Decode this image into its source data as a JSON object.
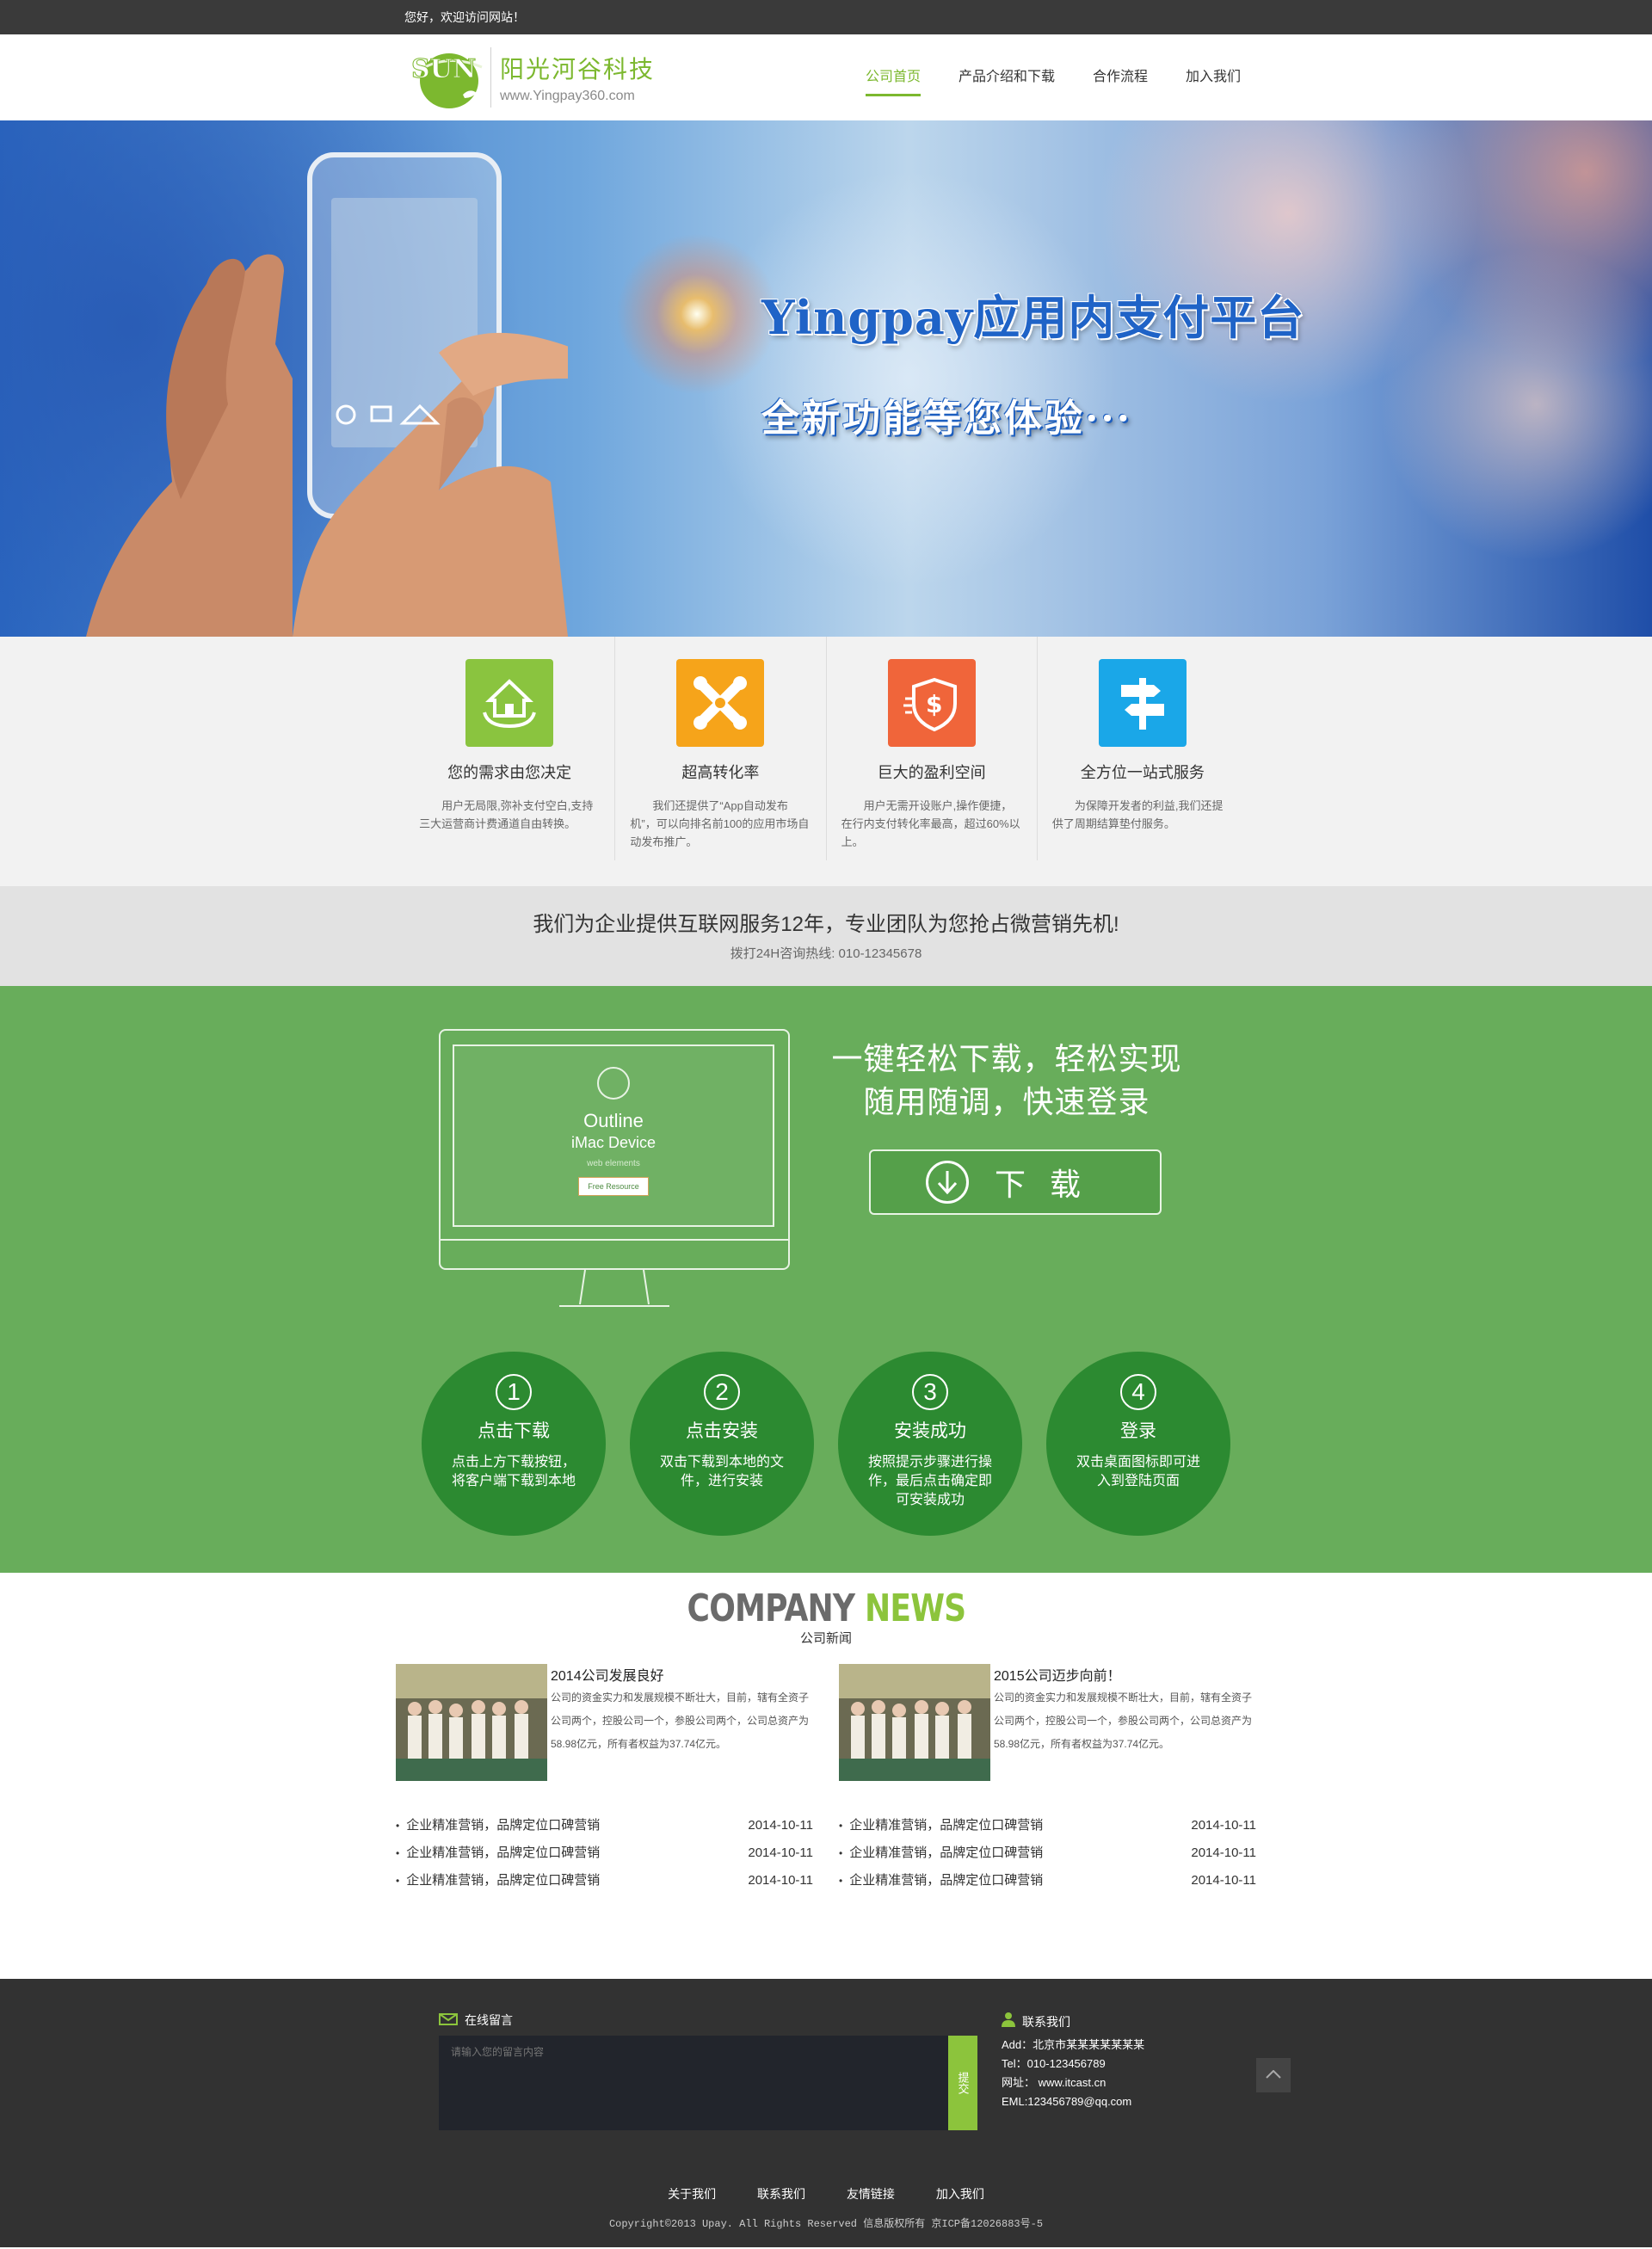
{
  "topbar": {
    "welcome": "您好，欢迎访问网站！"
  },
  "header": {
    "logo_badge": "SUN",
    "logo_cn": "阳光河谷科技",
    "logo_en": "www.Yingpay360.com",
    "nav": [
      {
        "label": "公司首页",
        "active": true
      },
      {
        "label": "产品介绍和下载",
        "active": false
      },
      {
        "label": "合作流程",
        "active": false
      },
      {
        "label": "加入我们",
        "active": false
      }
    ]
  },
  "banner": {
    "title": "Yingpay应用内支付平台",
    "subtitle": "全新功能等您体验···"
  },
  "features": [
    {
      "icon": "house-hands-icon",
      "color": "#8ac43f",
      "title": "您的需求由您决定",
      "desc": "用户无局限,弥补支付空白,支持三大运营商计费通道自由转换。"
    },
    {
      "icon": "puzzle-x-icon",
      "color": "#f6a41a",
      "title": "超高转化率",
      "desc": "我们还提供了“App自动发布机”，可以向排名前100的应用市场自动发布推广。"
    },
    {
      "icon": "dollar-shield-icon",
      "color": "#f0653a",
      "title": "巨大的盈利空间",
      "desc": "用户无需开设账户,操作便捷，在行内支付转化率最高，超过60%以上。"
    },
    {
      "icon": "signpost-icon",
      "color": "#1aa7e8",
      "title": "全方位一站式服务",
      "desc": "为保障开发者的利益,我们还提供了周期结算垫付服务。"
    }
  ],
  "slogan": {
    "title": "我们为企业提供互联网服务12年，专业团队为您抢占微营销先机!",
    "hotline": "拨打24H咨询热线: 010-12345678"
  },
  "download": {
    "mac_title": "Outline",
    "mac_sub": "iMac Device",
    "mac_small": "web elements",
    "mac_btn": "Free Resource",
    "line1": "一键轻松下载，轻松实现",
    "line2": "随用随调，快速登录",
    "button": "下载",
    "steps": [
      {
        "num": "1",
        "title": "点击下载",
        "desc": "点击上方下载按钮，将客户端下载到本地"
      },
      {
        "num": "2",
        "title": "点击安装",
        "desc": "双击下载到本地的文件，进行安装"
      },
      {
        "num": "3",
        "title": "安装成功",
        "desc": "按照提示步骤进行操作，最后点击确定即可安装成功"
      },
      {
        "num": "4",
        "title": "登录",
        "desc": "双击桌面图标即可进入到登陆页面"
      }
    ]
  },
  "news": {
    "title_a": "COMPANY",
    "title_b": "NEWS",
    "subtitle": "公司新闻",
    "columns": [
      {
        "headline": "2014公司发展良好",
        "summary": "公司的资金实力和发展规模不断壮大，目前，辖有全资子公司两个，控股公司一个，参股公司两个，公司总资产为58.98亿元，所有者权益为37.74亿元。",
        "items": [
          {
            "title": "企业精准营销，品牌定位口碑营销",
            "date": "2014-10-11"
          },
          {
            "title": "企业精准营销，品牌定位口碑营销",
            "date": "2014-10-11"
          },
          {
            "title": "企业精准营销，品牌定位口碑营销",
            "date": "2014-10-11"
          }
        ]
      },
      {
        "headline": "2015公司迈步向前！",
        "summary": "公司的资金实力和发展规模不断壮大，目前，辖有全资子公司两个，控股公司一个，参股公司两个，公司总资产为58.98亿元，所有者权益为37.74亿元。",
        "items": [
          {
            "title": "企业精准营销，品牌定位口碑营销",
            "date": "2014-10-11"
          },
          {
            "title": "企业精准营销，品牌定位口碑营销",
            "date": "2014-10-11"
          },
          {
            "title": "企业精准营销，品牌定位口碑营销",
            "date": "2014-10-11"
          }
        ]
      }
    ]
  },
  "footer": {
    "msg_title": "在线留言",
    "msg_placeholder": "请输入您的留言内容",
    "submit": "提交",
    "contact_title": "联系我们",
    "add": "Add：北京市某某某某某某某",
    "tel": "Tel：010-123456789",
    "web": "网址： www.itcast.cn",
    "email": "EML:123456789@qq.com",
    "links": [
      "关于我们",
      "联系我们",
      "友情链接",
      "加入我们"
    ],
    "copyright": "Copyright©2013 Upay. All Rights Reserved  信息版权所有 京ICP备12026883号-5"
  },
  "colors": {
    "brand_green": "#7cb82f",
    "section_green": "#68ad5b",
    "step_green": "#2c8a31",
    "footer_bg": "#323232"
  }
}
